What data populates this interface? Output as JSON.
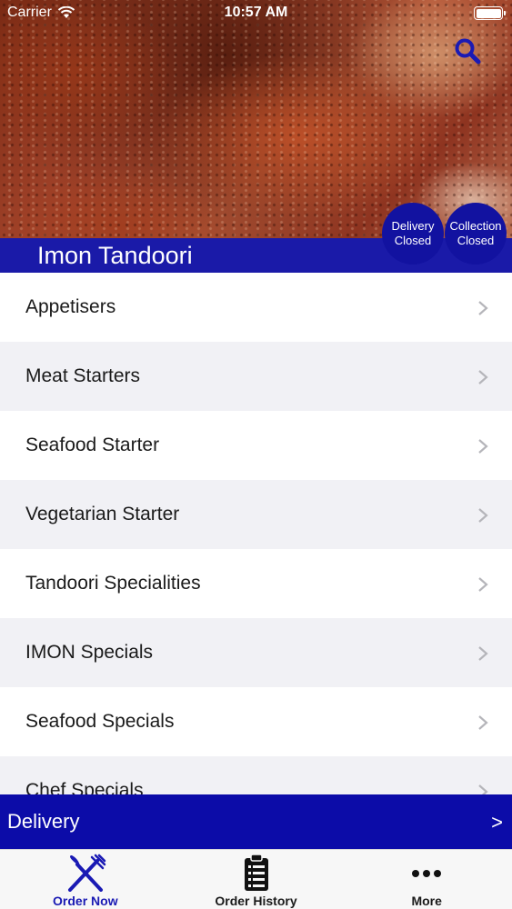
{
  "status_bar": {
    "carrier": "Carrier",
    "time": "10:57 AM"
  },
  "header": {
    "restaurant_name": "Imon Tandoori",
    "delivery_status": {
      "line1": "Delivery",
      "line2": "Closed"
    },
    "collection_status": {
      "line1": "Collection",
      "line2": "Closed"
    },
    "search_icon": "search-icon"
  },
  "menu": {
    "items": [
      {
        "label": "Appetisers"
      },
      {
        "label": "Meat Starters"
      },
      {
        "label": "Seafood Starter"
      },
      {
        "label": "Vegetarian Starter"
      },
      {
        "label": "Tandoori Specialities"
      },
      {
        "label": "IMON Specials"
      },
      {
        "label": "Seafood Specials"
      },
      {
        "label": "Chef Specials"
      }
    ]
  },
  "delivery_bar": {
    "label": "Delivery",
    "arrow": ">"
  },
  "tab_bar": {
    "tabs": [
      {
        "label": "Order Now",
        "icon": "fork-knife-icon",
        "active": true
      },
      {
        "label": "Order History",
        "icon": "clipboard-list-icon",
        "active": false
      },
      {
        "label": "More",
        "icon": "more-dots-icon",
        "active": false
      }
    ]
  },
  "colors": {
    "brand_blue": "#1a1aa8",
    "delivery_bar_blue": "#0c0ca8",
    "active_tab": "#1a1ab4"
  }
}
